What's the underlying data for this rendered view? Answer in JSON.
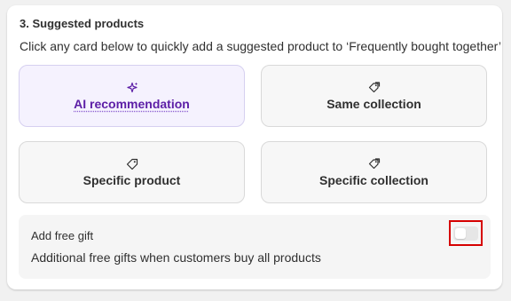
{
  "section": {
    "title": "3. Suggested products",
    "instructions": "Click any card below to quickly add a suggested product to ‘Frequently bought together’"
  },
  "cards": [
    {
      "label": "AI recommendation",
      "icon": "sparkles-icon"
    },
    {
      "label": "Same collection",
      "icon": "collection-tags-icon"
    },
    {
      "label": "Specific product",
      "icon": "tag-icon"
    },
    {
      "label": "Specific collection",
      "icon": "collection-tags-icon"
    }
  ],
  "free_gift": {
    "title": "Add free gift",
    "description": "Additional free gifts when customers buy all products",
    "enabled": false
  },
  "colors": {
    "ai_accent": "#5c1ea6",
    "highlight": "#d60000"
  }
}
